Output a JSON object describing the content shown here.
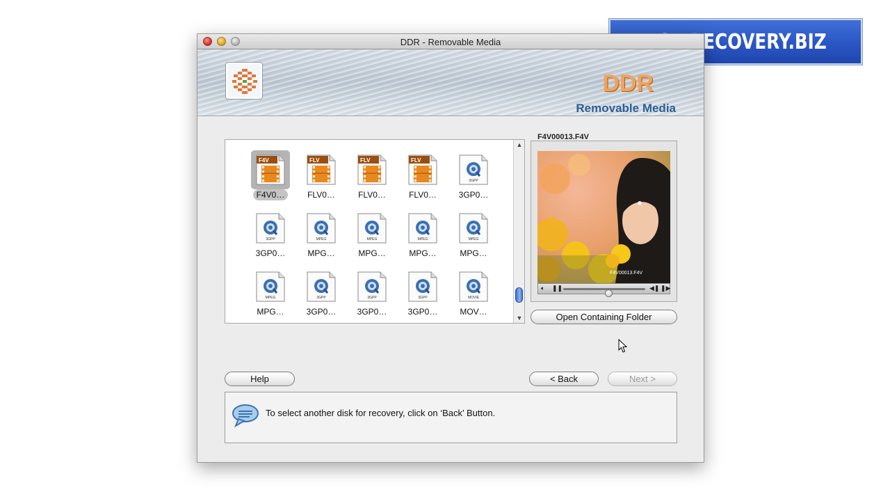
{
  "watermark": {
    "text": "USB RECOVERY.BIZ"
  },
  "window": {
    "title": "DDR - Removable Media"
  },
  "header": {
    "brand": "DDR",
    "subtitle": "Removable Media"
  },
  "files": [
    {
      "label": "F4V0…",
      "type": "F4V",
      "selected": true
    },
    {
      "label": "FLV0…",
      "type": "FLV",
      "selected": false
    },
    {
      "label": "FLV0…",
      "type": "FLV",
      "selected": false
    },
    {
      "label": "FLV0…",
      "type": "FLV",
      "selected": false
    },
    {
      "label": "3GP0…",
      "type": "3GPP",
      "selected": false
    },
    {
      "label": "3GP0…",
      "type": "3GPP",
      "selected": false
    },
    {
      "label": "MPG…",
      "type": "MPEG",
      "selected": false
    },
    {
      "label": "MPG…",
      "type": "MPEG",
      "selected": false
    },
    {
      "label": "MPG…",
      "type": "MPEG",
      "selected": false
    },
    {
      "label": "MPG…",
      "type": "MPEG",
      "selected": false
    },
    {
      "label": "MPG…",
      "type": "MPEG",
      "selected": false
    },
    {
      "label": "3GP0…",
      "type": "3GPP",
      "selected": false
    },
    {
      "label": "3GP0…",
      "type": "3GPP",
      "selected": false
    },
    {
      "label": "3GP0…",
      "type": "3GPP",
      "selected": false
    },
    {
      "label": "MOV…",
      "type": "MOVIE",
      "selected": false
    }
  ],
  "preview": {
    "filename": "F4V00013.F4V",
    "video_overlay": "F4V00013.F4V"
  },
  "buttons": {
    "open_folder": "Open Containing Folder",
    "help": "Help",
    "back": "< Back",
    "next": "Next >"
  },
  "message": {
    "text": "To select another disk for recovery, click on ‘Back’ Button."
  },
  "colors": {
    "accent": "#2d5e95",
    "brand_orange": "#f2a35a",
    "flv_orange": "#e8891f",
    "selection_gray": "#b4b4b4"
  }
}
